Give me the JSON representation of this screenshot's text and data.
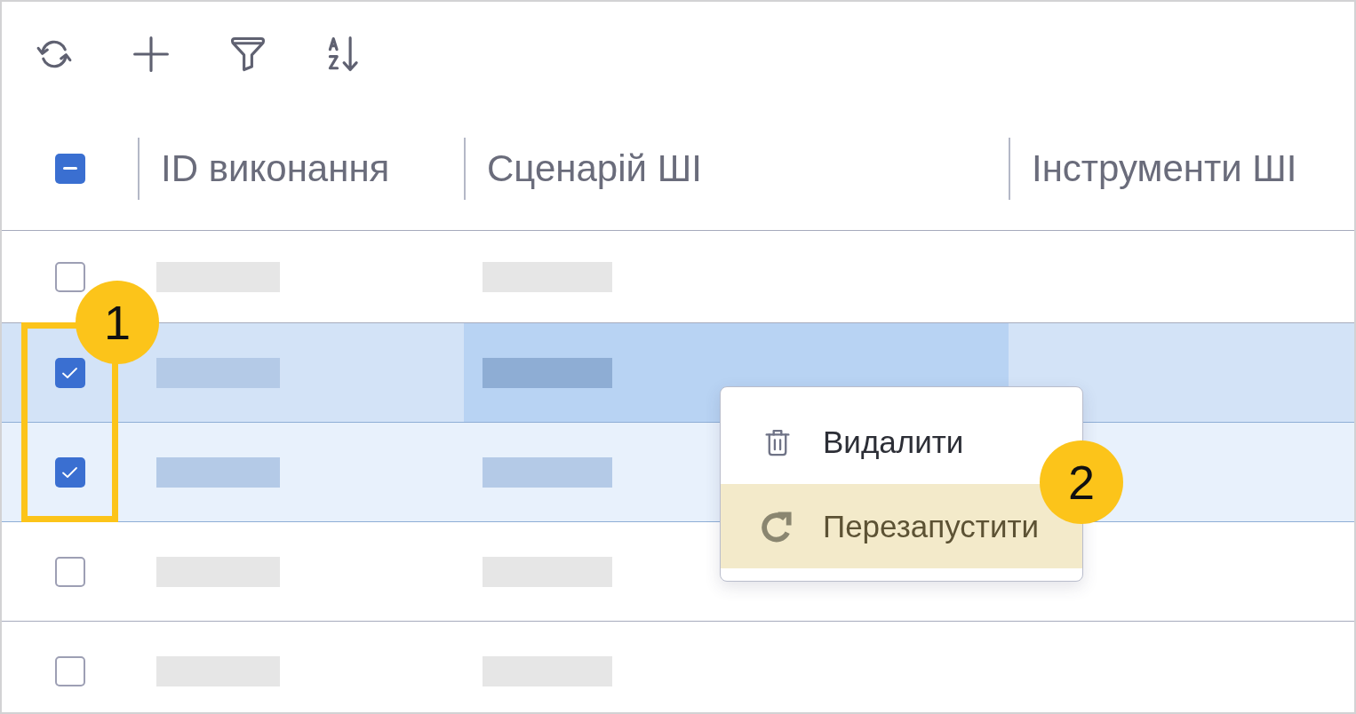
{
  "table": {
    "select_all": {
      "indeterminate": true
    },
    "columns": [
      {
        "label": "ID виконання"
      },
      {
        "label": "Сценарій ШІ"
      },
      {
        "label": "Інструменти ШІ"
      }
    ],
    "rows": [
      {
        "checked": false,
        "active": false,
        "cells": [
          {
            "redacted": true,
            "focused": false
          },
          {
            "redacted": true,
            "focused": false
          }
        ]
      },
      {
        "checked": true,
        "active": true,
        "cells": [
          {
            "redacted": true,
            "focused": false
          },
          {
            "redacted": true,
            "focused": true
          }
        ]
      },
      {
        "checked": true,
        "active": false,
        "cells": [
          {
            "redacted": true,
            "focused": false
          },
          {
            "redacted": true,
            "focused": false
          }
        ]
      },
      {
        "checked": false,
        "active": false,
        "cells": [
          {
            "redacted": true,
            "focused": false
          },
          {
            "redacted": true,
            "focused": false
          }
        ]
      },
      {
        "checked": false,
        "active": false,
        "cells": [
          {
            "redacted": true,
            "focused": false
          },
          {
            "redacted": true,
            "focused": false
          }
        ]
      }
    ]
  },
  "context_menu": {
    "items": [
      {
        "kind": "delete",
        "label": "Видалити",
        "selected": false
      },
      {
        "kind": "restart",
        "label": "Перезапустити",
        "selected": true
      }
    ]
  },
  "annotations": [
    {
      "label": "1",
      "frame": true
    },
    {
      "label": "2",
      "frame": false
    }
  ]
}
